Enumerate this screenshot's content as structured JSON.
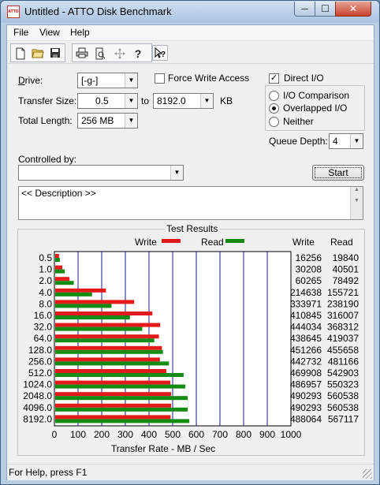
{
  "window": {
    "icon_text": "ATTO",
    "title": "Untitled - ATTO Disk Benchmark",
    "minimize_glyph": "─",
    "maximize_glyph": "☐",
    "close_glyph": "✕"
  },
  "menu": [
    "File",
    "View",
    "Help"
  ],
  "toolbar": [
    "new-icon",
    "open-icon",
    "save-icon",
    "print-icon",
    "print-preview-icon",
    "move-icon",
    "help-icon",
    "context-help-icon"
  ],
  "form": {
    "drive_label": "Drive:",
    "drive_value": "[-g-]",
    "force_write_label": "Force Write Access",
    "force_write_checked": false,
    "direct_io_label": "Direct I/O",
    "direct_io_checked": true,
    "transfer_size_label": "Transfer Size:",
    "transfer_from": "0.5",
    "to_label": "to",
    "transfer_to": "8192.0",
    "kb_label": "KB",
    "total_length_label": "Total Length:",
    "total_length_value": "256 MB",
    "io_comparison_label": "I/O Comparison",
    "overlapped_io_label": "Overlapped I/O",
    "neither_label": "Neither",
    "selected_mode": "Overlapped I/O",
    "queue_depth_label": "Queue Depth:",
    "queue_depth_value": "4",
    "controlled_by_label": "Controlled by:",
    "controlled_by_value": "",
    "start_label": "Start",
    "description": "<< Description >>"
  },
  "results": {
    "title": "Test Results",
    "write_legend": "Write",
    "read_legend": "Read",
    "write_col": "Write",
    "read_col": "Read"
  },
  "chart_data": {
    "type": "bar",
    "orientation": "horizontal",
    "xlabel": "Transfer Rate - MB / Sec",
    "xlim": [
      0,
      1000
    ],
    "xticks": [
      "0",
      "100",
      "200",
      "300",
      "400",
      "500",
      "600",
      "700",
      "800",
      "900",
      "1000"
    ],
    "grid": true,
    "categories": [
      "0.5",
      "1.0",
      "2.0",
      "4.0",
      "8.0",
      "16.0",
      "32.0",
      "64.0",
      "128.0",
      "256.0",
      "512.0",
      "1024.0",
      "2048.0",
      "4096.0",
      "8192.0"
    ],
    "series": [
      {
        "name": "Write",
        "color": "#e31a1a",
        "values": [
          16256,
          30208,
          60265,
          214638,
          333971,
          410845,
          444034,
          438645,
          451266,
          442732,
          469908,
          486957,
          490293,
          490293,
          488064
        ]
      },
      {
        "name": "Read",
        "color": "#148c14",
        "values": [
          19840,
          40501,
          78492,
          155721,
          238190,
          316007,
          368312,
          419037,
          455658,
          481166,
          542903,
          550323,
          560538,
          560538,
          567117
        ]
      }
    ]
  },
  "status": "For Help, press F1",
  "colors": {
    "write": "#e31a1a",
    "read": "#148c14",
    "grid_line": "#1a1a8c"
  }
}
